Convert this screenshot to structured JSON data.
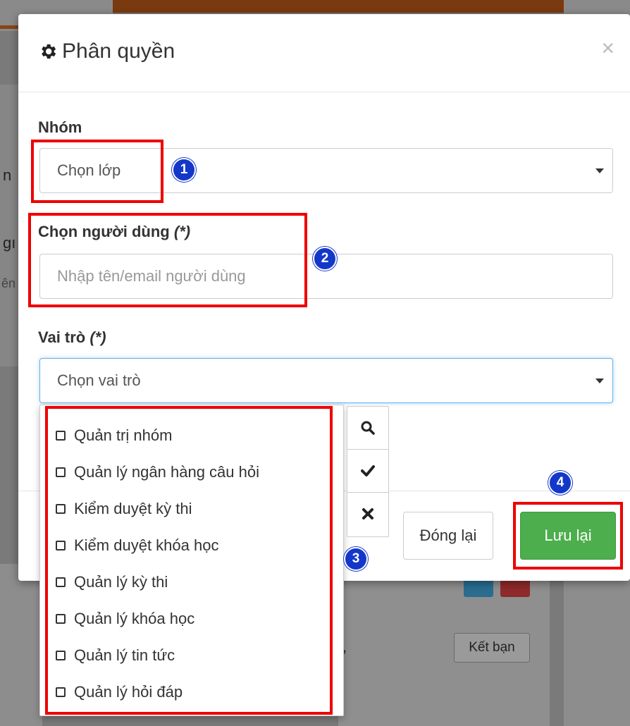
{
  "modal": {
    "title": "Phân quyền",
    "close_label": "×",
    "group_label": "Nhóm",
    "group_select_value": "Chọn lớp",
    "user_label": "Chọn người dùng",
    "required_mark": "(*)",
    "user_input_placeholder": "Nhập tên/email người dùng",
    "role_label": "Vai trò",
    "role_select_value": "Chọn vai trò",
    "role_options": [
      "Quản trị nhóm",
      "Quản lý ngân hàng câu hỏi",
      "Kiểm duyệt kỳ thi",
      "Kiểm duyệt khóa học",
      "Quản lý kỳ thi",
      "Quản lý khóa học",
      "Quản lý tin tức",
      "Quản lý hỏi đáp"
    ],
    "tools": [
      "search-icon",
      "check-icon",
      "times-icon"
    ],
    "close_button": "Đóng lại",
    "save_button": "Lưu lại"
  },
  "annotations": [
    "1",
    "2",
    "3",
    "4"
  ],
  "background": {
    "friend_button": "Kết bạn",
    "left_fragment_1": "n",
    "left_fragment_2": "gı",
    "left_fragment_3": "ên",
    "comma": ","
  },
  "colors": {
    "highlight": "#e00000",
    "badge": "#1338c9",
    "save": "#4cae4c",
    "overlay": "#7a7a7a"
  }
}
